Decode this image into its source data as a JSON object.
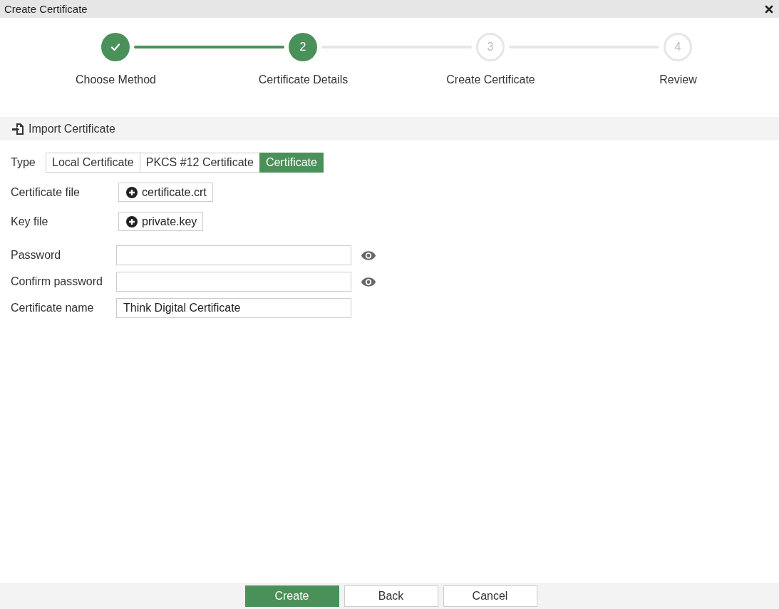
{
  "window": {
    "title": "Create Certificate"
  },
  "steps": [
    {
      "label": "Choose Method",
      "kind": "done"
    },
    {
      "number": "2",
      "label": "Certificate Details",
      "kind": "current"
    },
    {
      "number": "3",
      "label": "Create Certificate",
      "kind": "pending"
    },
    {
      "number": "4",
      "label": "Review",
      "kind": "pending"
    }
  ],
  "section": {
    "title": "Import Certificate"
  },
  "type": {
    "label": "Type",
    "options": [
      {
        "label": "Local Certificate",
        "selected": false
      },
      {
        "label": "PKCS #12 Certificate",
        "selected": false
      },
      {
        "label": "Certificate",
        "selected": true
      }
    ]
  },
  "files": [
    {
      "label": "Certificate file",
      "value": "certificate.crt"
    },
    {
      "label": "Key file",
      "value": "private.key"
    }
  ],
  "fields": [
    {
      "label": "Password",
      "reveal": true
    },
    {
      "label": "Confirm password",
      "reveal": true
    },
    {
      "label": "Certificate name",
      "value": "Think Digital Certificate",
      "reveal": false
    }
  ],
  "buttons": [
    {
      "label": "Create",
      "primary": true
    },
    {
      "label": "Back",
      "primary": false
    },
    {
      "label": "Cancel",
      "primary": false
    }
  ]
}
